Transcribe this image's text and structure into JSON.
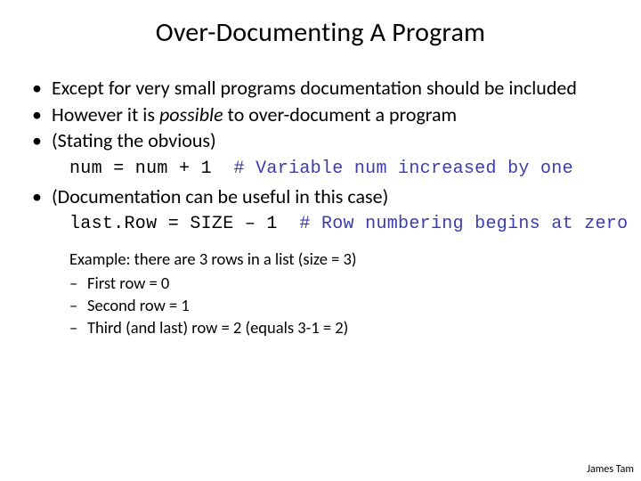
{
  "title": "Over-Documenting A Program",
  "bullets": {
    "b0": "Except for very small programs documentation should be included",
    "b1a": "However it is ",
    "b1b": "possible",
    "b1c": " to over-document a program",
    "b2": "(Stating the obvious)",
    "b3": "(Documentation can be useful in this case)"
  },
  "code1": {
    "stmt": "num = num + 1  ",
    "comment": "# Variable num increased by one"
  },
  "code2": {
    "stmt": "last.Row = SIZE – 1  ",
    "comment": "# Row numbering begins at zero"
  },
  "example": {
    "lead": "Example: there are 3 rows in a list (size = 3)",
    "d0": "First row = 0",
    "d1": "Second row = 1",
    "d2": "Third (and last) row = 2 (equals 3-1 = 2)"
  },
  "footer": "James Tam"
}
